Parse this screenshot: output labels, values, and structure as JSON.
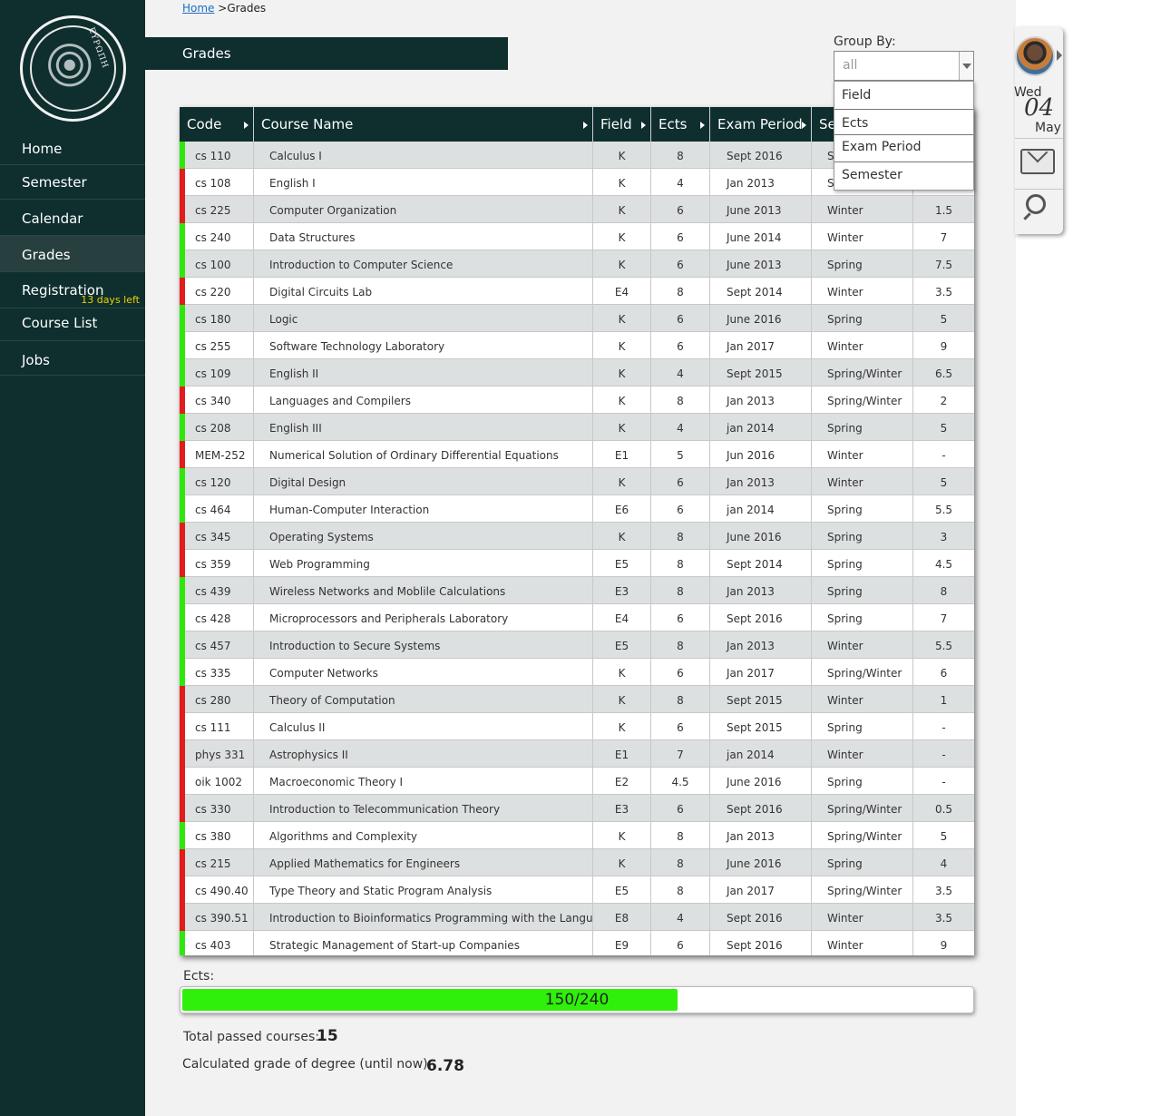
{
  "sidebar": {
    "logo_text": "ΕΥΡΩΠΗ",
    "items": [
      {
        "label": "Home"
      },
      {
        "label": "Semester"
      },
      {
        "label": "Calendar"
      },
      {
        "label": "Grades",
        "active": true
      },
      {
        "label": "Registration",
        "badge": "13 days left"
      },
      {
        "label": "Course List"
      },
      {
        "label": "Jobs"
      }
    ]
  },
  "breadcrumb": {
    "home": "Home",
    "sep": ">",
    "current": "Grades"
  },
  "page_title": "Grades",
  "group_by": {
    "label": "Group By:",
    "value": "all",
    "options": [
      "Field",
      "Ects",
      "Exam Period",
      "Semester"
    ]
  },
  "table": {
    "headers": {
      "code": "Code",
      "name": "Course Name",
      "field": "Field",
      "ects": "Ects",
      "exam": "Exam Period",
      "sem": "Se"
    },
    "rows": [
      {
        "code": "cs 110",
        "name": "Calculus I",
        "field": "K",
        "ects": "8",
        "exam": "Sept 2016",
        "sem": "Spring",
        "grade": "",
        "status": "pass"
      },
      {
        "code": "cs 108",
        "name": "English I",
        "field": "K",
        "ects": "4",
        "exam": "Jan 2013",
        "sem": "Spring",
        "grade": "",
        "status": "fail"
      },
      {
        "code": "cs 225",
        "name": "Computer Organization",
        "field": "K",
        "ects": "6",
        "exam": "June 2013",
        "sem": "Winter",
        "grade": "1.5",
        "status": "fail"
      },
      {
        "code": "cs 240",
        "name": "Data Structures",
        "field": "K",
        "ects": "6",
        "exam": "June 2014",
        "sem": "Winter",
        "grade": "7",
        "status": "pass"
      },
      {
        "code": "cs 100",
        "name": "Introduction to Computer Science",
        "field": "K",
        "ects": "6",
        "exam": "June 2013",
        "sem": "Spring",
        "grade": "7.5",
        "status": "pass"
      },
      {
        "code": "cs 220",
        "name": "Digital Circuits Lab",
        "field": "E4",
        "ects": "8",
        "exam": "Sept 2014",
        "sem": "Winter",
        "grade": "3.5",
        "status": "fail"
      },
      {
        "code": "cs 180",
        "name": "Logic",
        "field": "K",
        "ects": "6",
        "exam": "June 2016",
        "sem": "Spring",
        "grade": "5",
        "status": "pass"
      },
      {
        "code": "cs 255",
        "name": "Software Technology Laboratory",
        "field": "K",
        "ects": "6",
        "exam": "Jan 2017",
        "sem": "Winter",
        "grade": "9",
        "status": "pass"
      },
      {
        "code": "cs 109",
        "name": "English II",
        "field": "K",
        "ects": "4",
        "exam": "Sept 2015",
        "sem": "Spring/Winter",
        "grade": "6.5",
        "status": "pass"
      },
      {
        "code": "cs 340",
        "name": "Languages and Compilers",
        "field": "K",
        "ects": "8",
        "exam": "Jan 2013",
        "sem": "Spring/Winter",
        "grade": "2",
        "status": "fail"
      },
      {
        "code": "cs 208",
        "name": "English III",
        "field": "K",
        "ects": "4",
        "exam": "jan 2014",
        "sem": "Spring",
        "grade": "5",
        "status": "pass"
      },
      {
        "code": "MEM-252",
        "name": "Numerical Solution of Ordinary Differential Equations",
        "field": "E1",
        "ects": "5",
        "exam": "Jun 2016",
        "sem": "Winter",
        "grade": "-",
        "status": "fail"
      },
      {
        "code": "cs 120",
        "name": "Digital Design",
        "field": "K",
        "ects": "6",
        "exam": "Jan 2013",
        "sem": "Winter",
        "grade": "5",
        "status": "pass"
      },
      {
        "code": "cs 464",
        "name": "Human-Computer Interaction",
        "field": "E6",
        "ects": "6",
        "exam": "jan 2014",
        "sem": "Spring",
        "grade": "5.5",
        "status": "pass"
      },
      {
        "code": "cs 345",
        "name": "Operating Systems",
        "field": "K",
        "ects": "8",
        "exam": "June 2016",
        "sem": "Spring",
        "grade": "3",
        "status": "fail"
      },
      {
        "code": "cs 359",
        "name": "Web Programming",
        "field": "E5",
        "ects": "8",
        "exam": "Sept 2014",
        "sem": "Spring",
        "grade": "4.5",
        "status": "fail"
      },
      {
        "code": "cs 439",
        "name": "Wireless Networks and Moblile Calculations",
        "field": "E3",
        "ects": "8",
        "exam": "Jan 2013",
        "sem": "Spring",
        "grade": "8",
        "status": "pass"
      },
      {
        "code": "cs 428",
        "name": "Microprocessors and Peripherals Laboratory",
        "field": "E4",
        "ects": "6",
        "exam": "Sept 2016",
        "sem": "Spring",
        "grade": "7",
        "status": "pass"
      },
      {
        "code": "cs 457",
        "name": "Introduction to Secure Systems",
        "field": "E5",
        "ects": "8",
        "exam": "Jan 2013",
        "sem": "Winter",
        "grade": "5.5",
        "status": "pass"
      },
      {
        "code": "cs 335",
        "name": "Computer Networks",
        "field": "K",
        "ects": "6",
        "exam": "Jan 2017",
        "sem": "Spring/Winter",
        "grade": "6",
        "status": "pass"
      },
      {
        "code": "cs 280",
        "name": "Theory of Computation",
        "field": "K",
        "ects": "8",
        "exam": "Sept 2015",
        "sem": "Winter",
        "grade": "1",
        "status": "fail"
      },
      {
        "code": "cs 111",
        "name": "Calculus II",
        "field": "K",
        "ects": "6",
        "exam": "Sept 2015",
        "sem": "Spring",
        "grade": "-",
        "status": "fail"
      },
      {
        "code": "phys 331",
        "name": "Astrophysics II",
        "field": "E1",
        "ects": "7",
        "exam": "jan 2014",
        "sem": "Winter",
        "grade": "-",
        "status": "fail"
      },
      {
        "code": "oik 1002",
        "name": "Macroeconomic Theory I",
        "field": "E2",
        "ects": "4.5",
        "exam": "June 2016",
        "sem": "Spring",
        "grade": "-",
        "status": "fail"
      },
      {
        "code": "cs 330",
        "name": "Introduction to Telecommunication Theory",
        "field": "E3",
        "ects": "6",
        "exam": "Sept 2016",
        "sem": "Spring/Winter",
        "grade": "0.5",
        "status": "fail"
      },
      {
        "code": "cs 380",
        "name": "Algorithms and Complexity",
        "field": "K",
        "ects": "8",
        "exam": "Jan 2013",
        "sem": "Spring/Winter",
        "grade": "5",
        "status": "pass"
      },
      {
        "code": "cs 215",
        "name": "Applied Mathematics for Engineers",
        "field": "K",
        "ects": "8",
        "exam": "June 2016",
        "sem": "Spring",
        "grade": "4",
        "status": "fail"
      },
      {
        "code": "cs 490.40",
        "name": "Type Theory and Static Program Analysis",
        "field": "E5",
        "ects": "8",
        "exam": "Jan 2017",
        "sem": "Spring/Winter",
        "grade": "3.5",
        "status": "fail"
      },
      {
        "code": "cs 390.51",
        "name": "Introduction to Bioinformatics Programming with the Language R",
        "field": "E8",
        "ects": "4",
        "exam": "Sept 2016",
        "sem": "Winter",
        "grade": "3.5",
        "status": "fail"
      },
      {
        "code": "cs 403",
        "name": "Strategic Management of Start-up Companies",
        "field": "E9",
        "ects": "6",
        "exam": "Sept 2016",
        "sem": "Winter",
        "grade": "9",
        "status": "pass"
      }
    ]
  },
  "ects_progress": {
    "label": "Ects:",
    "text": "150/240",
    "fraction": 0.625
  },
  "stats": {
    "passed_label": "Total passed courses:",
    "passed_value": "15",
    "grade_label": "Calculated grade of degree (until now):",
    "grade_value": "6.78"
  },
  "widget": {
    "day": "Wed",
    "date": "04",
    "month": "May"
  },
  "colors": {
    "pass": "#2ee80b",
    "fail": "#e21b1b",
    "sidebar": "#0f2e2e",
    "progress": "#2ef00b"
  },
  "icons": [
    "avatar",
    "chevron-right-icon",
    "mail-icon",
    "search-icon",
    "sort-arrow-icon",
    "dropdown-arrow-icon"
  ]
}
